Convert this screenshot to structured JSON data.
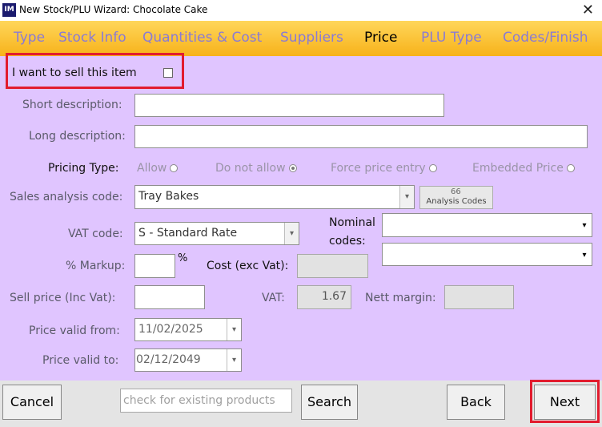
{
  "window": {
    "title": "New Stock/PLU Wizard: Chocolate Cake",
    "icon": "IM"
  },
  "tabs": [
    "Type",
    "Stock Info",
    "Quantities & Cost",
    "Suppliers",
    "Price",
    "PLU Type",
    "Codes/Finish"
  ],
  "active_tab": "Price",
  "form": {
    "sell_item_label": "I want to sell this item",
    "short_description_label": "Short description:",
    "short_description_value": "",
    "long_description_label": "Long description:",
    "long_description_value": "",
    "pricing_type_label": "Pricing Type:",
    "pricing_options": [
      {
        "label": "Allow",
        "selected": false
      },
      {
        "label": "Do not allow",
        "selected": true
      },
      {
        "label": "Force price entry",
        "selected": false
      },
      {
        "label": "Embedded Price",
        "selected": false
      }
    ],
    "sales_analysis_label": "Sales analysis code:",
    "sales_analysis_value": "Tray Bakes",
    "analysis_codes_button": "Analysis Codes",
    "vat_code_label": "VAT code:",
    "vat_code_value": "S - Standard Rate",
    "nominal_codes_label_1": "Nominal",
    "nominal_codes_label_2": "codes:",
    "markup_label": "% Markup:",
    "markup_value": "",
    "percent_sign": "%",
    "cost_label": "Cost (exc Vat):",
    "cost_value": "",
    "sell_price_label": "Sell price (Inc Vat):",
    "sell_price_value": "",
    "vat_label": "VAT:",
    "vat_value": "1.67",
    "nett_margin_label": "Nett margin:",
    "nett_margin_value": "",
    "price_valid_from_label": "Price valid from:",
    "price_valid_from_value": "11/02/2025",
    "price_valid_to_label": "Price valid to:",
    "price_valid_to_value": "02/12/2049"
  },
  "footer": {
    "cancel": "Cancel",
    "search_placeholder": "check for existing products",
    "search": "Search",
    "back": "Back",
    "next": "Next"
  },
  "icons": {
    "close": "close-icon",
    "dropdown": "chevron-down-icon",
    "analysis": "glasses-icon"
  },
  "colors": {
    "panel": "#e0c5ff",
    "tab_gradient_top": "#ffd65a",
    "tab_gradient_bottom": "#f7b21a",
    "highlight": "#e21b2e",
    "inactive_tab": "#8a7bd4"
  }
}
